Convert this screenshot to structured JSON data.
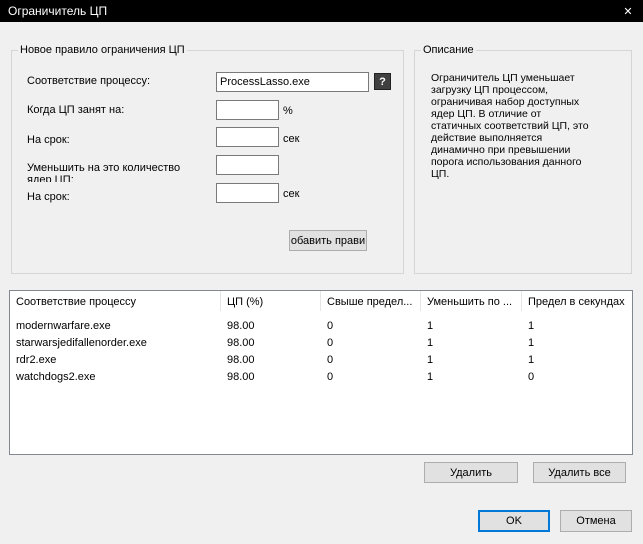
{
  "window": {
    "title": "Ограничитель ЦП",
    "close_glyph": "✕"
  },
  "new_rule": {
    "title": "Новое правило ограничения ЦП",
    "process_label": "Соответствие процессу:",
    "process_value": "ProcessLasso.exe",
    "help_glyph": "?",
    "cpu_busy_label": "Когда ЦП занят на:",
    "cpu_busy_value": "",
    "percent_unit": "%",
    "duration_label": "На срок:",
    "duration_value": "",
    "sec_unit": "сек",
    "reduce_label": "Уменьшить на это количество ядер ЦП:",
    "reduce_value": "",
    "duration2_label": "На срок:",
    "duration2_value": "",
    "sec_unit2": "сек",
    "add_button": "обавить прави"
  },
  "description": {
    "title": "Описание",
    "text": "Ограничитель ЦП уменьшает загрузку ЦП процессом, ограничивая набор доступных ядер ЦП. В отличие от статичных соответствий ЦП, это действие выполняется динамично при превышении порога использования данного ЦП."
  },
  "table": {
    "columns": [
      "Соответствие процессу",
      "ЦП (%)",
      "Свыше предел...",
      "Уменьшить по ...",
      "Предел в секундах"
    ],
    "rows": [
      [
        "modernwarfare.exe",
        "98.00",
        "0",
        "1",
        "1"
      ],
      [
        "starwarsjedifallenorder.exe",
        "98.00",
        "0",
        "1",
        "1"
      ],
      [
        "rdr2.exe",
        "98.00",
        "0",
        "1",
        "1"
      ],
      [
        "watchdogs2.exe",
        "98.00",
        "0",
        "1",
        "0"
      ]
    ]
  },
  "buttons": {
    "delete": "Удалить",
    "delete_all": "Удалить все",
    "ok": "OK",
    "cancel": "Отмена"
  }
}
